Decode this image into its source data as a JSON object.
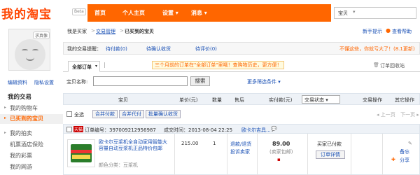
{
  "header": {
    "logo": "我的淘宝",
    "beta": "Beta",
    "nav": [
      "首页",
      "个人主页",
      "设置 ▾",
      "消息 ▾"
    ],
    "search_select": "宝贝"
  },
  "sidebar": {
    "avatar_bubble": "求真像",
    "edit_profile": "编辑资料",
    "privacy": "隐私设置",
    "my_trade": "我的交易",
    "cart": "我的购物车",
    "bought": "已买到的宝贝",
    "items": [
      "我的拍卖",
      "机票酒店保险",
      "我的彩票",
      "我的网游"
    ]
  },
  "crumbs": {
    "my_buy": "我是买家",
    "trade_mgmt": "交易管理",
    "current": "已买到的宝贝",
    "newbie": "新手提示",
    "help": "查看帮助"
  },
  "remind": {
    "label": "我的交易提醒：",
    "items": [
      "待付款(0)",
      "待确认收货",
      "待评价(0)"
    ],
    "promo": "不懂这些，你就亏大了！(8.1更新)"
  },
  "tabs": {
    "all": "全部订单",
    "notice": "三个月前的订单在\"全部订单\"里哦！查购物历史，更方便！",
    "recycle": "订单回收站"
  },
  "search": {
    "label": "宝贝名称:",
    "button": "搜索",
    "more": "更多筛选条件 ▾"
  },
  "table": {
    "headers": [
      "宝贝",
      "单价(元)",
      "数量",
      "售后",
      "实付款(元)",
      "交易状态 ▾",
      "交易操作",
      "其它操作"
    ]
  },
  "actions": {
    "select_all": "全选",
    "pay": "合并付款",
    "pay_for": "合并代付",
    "confirm": "批量确认收货",
    "prev": "◂ 上一页",
    "next": "下一页 ▸"
  },
  "order": {
    "tag": "天猫",
    "order_no": "订单编号：397009212956987",
    "time": "成交时间：2013-08-04 22:25",
    "shop": "欧卡尔吉具...",
    "title": "欧卡尔豆浆机全自动家用智能大容量自动豆浆机正品特价包邮",
    "color": "颜色分类：豆浆机",
    "price": "215.00",
    "qty": "1",
    "after_sale": [
      "退款/退货",
      "投诉卖家"
    ],
    "paid": "89.00",
    "paid_note": "(卖家包邮)",
    "status": "买家已付款",
    "detail": "订单详情",
    "note": "备忘",
    "share": "分享"
  }
}
